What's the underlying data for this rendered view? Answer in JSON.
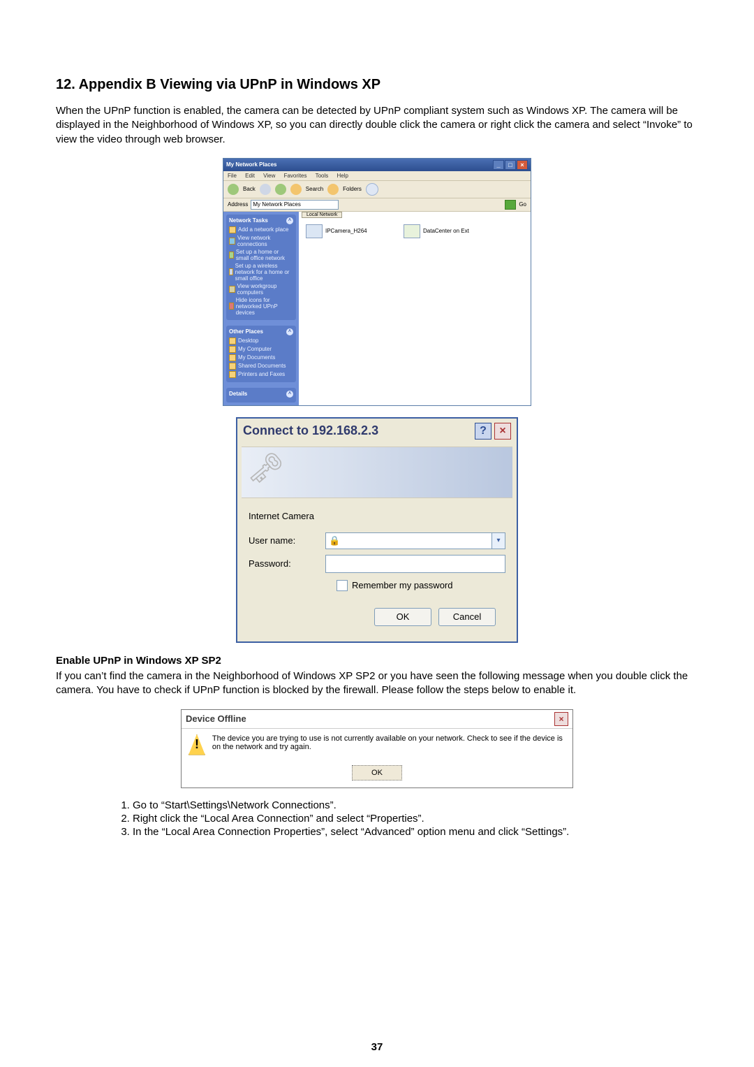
{
  "heading": "12. Appendix B Viewing via UPnP in Windows XP",
  "intro": "When the UPnP function is enabled, the camera can be detected by UPnP compliant system such as Windows XP. The camera will be displayed in the Neighborhood of Windows XP, so you can directly double click the camera or right click the camera and select “Invoke” to view the video through web browser.",
  "fig1": {
    "title": "My Network Places",
    "menu": [
      "File",
      "Edit",
      "View",
      "Favorites",
      "Tools",
      "Help"
    ],
    "toolbar": {
      "back": "Back",
      "search": "Search",
      "folders": "Folders"
    },
    "address_label": "Address",
    "address_value": "My Network Places",
    "go": "Go",
    "side_tasks_title": "Network Tasks",
    "side_tasks": [
      "Add a network place",
      "View network connections",
      "Set up a home or small office network",
      "Set up a wireless network for a home or small office",
      "View workgroup computers",
      "Hide icons for networked UPnP devices"
    ],
    "other_title": "Other Places",
    "other": [
      "Desktop",
      "My Computer",
      "My Documents",
      "Shared Documents",
      "Printers and Faxes"
    ],
    "details_title": "Details",
    "local_net": "Local Network",
    "dev1": "IPCamera_H264",
    "dev2": "DataCenter on Ext"
  },
  "fig2": {
    "title": "Connect to 192.168.2.3",
    "realm": "Internet Camera",
    "user_label": "User name:",
    "password_label": "Password:",
    "remember": "Remember my password",
    "ok": "OK",
    "cancel": "Cancel"
  },
  "enable_heading": "Enable UPnP in Windows XP SP2",
  "enable_text": "If you can’t find the camera in the Neighborhood of Windows XP SP2 or you have seen the following message when you double click the camera. You have to check if UPnP function is blocked by the firewall. Please follow the steps below to enable it.",
  "fig3": {
    "title": "Device Offline",
    "msg": "The device you are trying to use is not currently available on your network. Check to see if the device is on the network and try again.",
    "ok": "OK"
  },
  "steps": [
    "Go to “Start\\Settings\\Network Connections”.",
    "Right click the “Local Area Connection” and select “Properties”.",
    "In the “Local Area Connection Properties”, select “Advanced” option menu and click “Settings”."
  ],
  "page_number": "37"
}
